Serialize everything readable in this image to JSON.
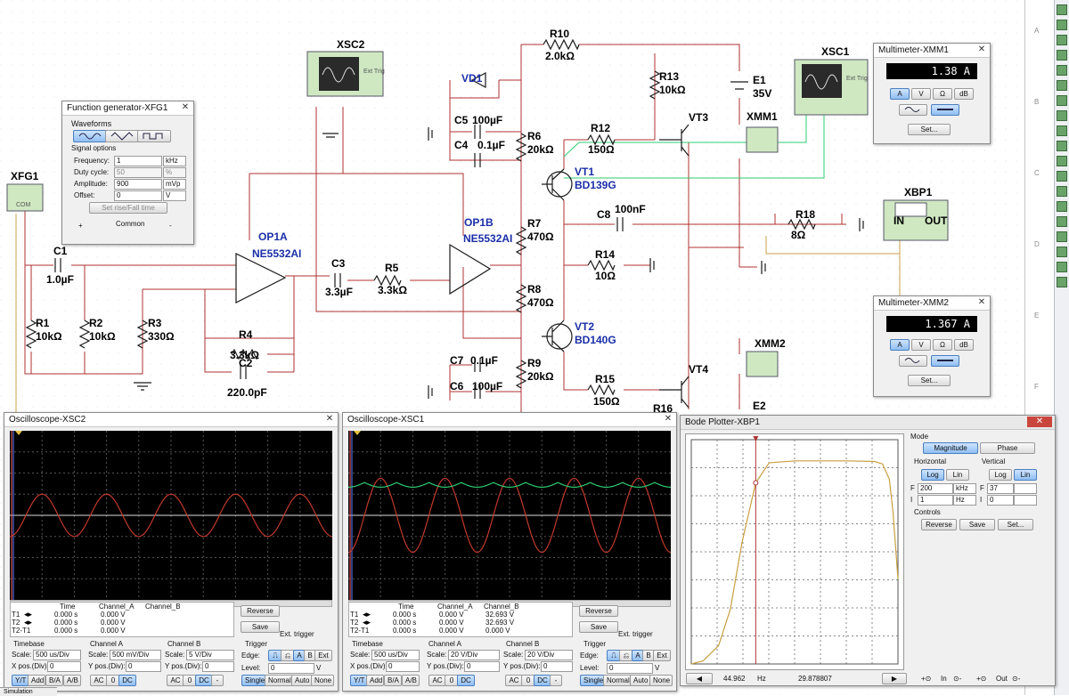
{
  "ruler": {
    "rows": [
      "A",
      "B",
      "C",
      "D",
      "E",
      "F"
    ]
  },
  "schematic": {
    "xfg1_label": "XFG1",
    "xsc2_label": "XSC2",
    "xsc1_label": "XSC1",
    "xbp1_label": "XBP1",
    "xmm1_label": "XMM1",
    "xmm2_label": "XMM2",
    "ext_trig": "Ext Trig",
    "vd1": "VD1",
    "vt1": "VT1",
    "vt1_part": "BD139G",
    "vt2": "VT2",
    "vt2_part": "BD140G",
    "vt3": "VT3",
    "vt4": "VT4",
    "e1": "E1",
    "e1_val": "35V",
    "e2": "E2",
    "op1a": "OP1A",
    "op1a_part": "NE5532AI",
    "op1b": "OP1B",
    "op1b_part": "NE5532AI",
    "c1": "C1",
    "c1_val": "1.0µF",
    "c2": "C2",
    "c2_val": "220.0pF",
    "c3": "C3",
    "c3_val": "3.3µF",
    "c4": "C4",
    "c4_val": "0.1µF",
    "c5": "C5",
    "c5_val": "100µF",
    "c6": "C6",
    "c6_val": "100µF",
    "c7": "C7",
    "c7_val": "0.1µF",
    "c8": "C8",
    "c8_val": "100nF",
    "r1": "R1",
    "r1_val": "10kΩ",
    "r2": "R2",
    "r2_val": "10kΩ",
    "r3": "R3",
    "r3_val": "330Ω",
    "r4": "R4",
    "r4_val": "3.3kΩ",
    "r5": "R5",
    "r5_val": "3.3kΩ",
    "r6": "R6",
    "r6_val": "20kΩ",
    "r7": "R7",
    "r7_val": "470Ω",
    "r8": "R8",
    "r8_val": "470Ω",
    "r9": "R9",
    "r9_val": "20kΩ",
    "r10": "R10",
    "r10_val": "2.0kΩ",
    "r12": "R12",
    "r12_val": "150Ω",
    "r13": "R13",
    "r13_val": "10kΩ",
    "r14": "R14",
    "r14_val": "10Ω",
    "r15": "R15",
    "r15_val": "150Ω",
    "r16": "R16",
    "r18": "R18",
    "r18_val": "8Ω",
    "in": "IN",
    "out": "OUT",
    "com": "COM"
  },
  "function_generator": {
    "title": "Function generator-XFG1",
    "waveforms_label": "Waveforms",
    "signal_options_label": "Signal options",
    "rows": [
      {
        "label": "Frequency:",
        "value": "1",
        "unit": "kHz"
      },
      {
        "label": "Duty cycle:",
        "value": "50",
        "unit": "%"
      },
      {
        "label": "Amplitude:",
        "value": "900",
        "unit": "mVp"
      },
      {
        "label": "Offset:",
        "value": "0",
        "unit": "V"
      }
    ],
    "rise_fall_button": "Set rise/Fall time",
    "plus": "+",
    "common": "Common",
    "minus": "-"
  },
  "multimeter1": {
    "title": "Multimeter-XMM1",
    "reading": "1.38 A",
    "modes": [
      "A",
      "V",
      "Ω",
      "dB"
    ],
    "set_button": "Set..."
  },
  "multimeter2": {
    "title": "Multimeter-XMM2",
    "reading": "1.367 A",
    "modes": [
      "A",
      "V",
      "Ω",
      "dB"
    ],
    "set_button": "Set..."
  },
  "osc_xsc2": {
    "title": "Oscilloscope-XSC2",
    "columns": [
      "Time",
      "Channel_A",
      "Channel_B"
    ],
    "rows": [
      {
        "name": "T1",
        "time": "0.000 s",
        "a": "0.000 V",
        "b": ""
      },
      {
        "name": "T2",
        "time": "0.000 s",
        "a": "0.000 V",
        "b": ""
      },
      {
        "name": "T2-T1",
        "time": "0.000 s",
        "a": "0.000 V",
        "b": ""
      }
    ],
    "reverse": "Reverse",
    "save": "Save",
    "ext_trigger": "Ext. trigger",
    "timebase": {
      "label": "Timebase",
      "scale_label": "Scale:",
      "scale": "500 us/Div",
      "pos_label": "X pos.(Div):",
      "pos": "0",
      "btns": [
        "Y/T",
        "Add",
        "B/A",
        "A/B"
      ]
    },
    "channel_a": {
      "label": "Channel A",
      "scale_label": "Scale:",
      "scale": "500 mV/Div",
      "pos_label": "Y pos.(Div):",
      "pos": "0",
      "btns": [
        "AC",
        "0",
        "DC"
      ]
    },
    "channel_b": {
      "label": "Channel B",
      "scale_label": "Scale:",
      "scale": "5 V/Div",
      "pos_label": "Y pos.(Div):",
      "pos": "0",
      "btns": [
        "AC",
        "0",
        "DC",
        "-"
      ]
    },
    "trigger": {
      "label": "Trigger",
      "edge_label": "Edge:",
      "level_label": "Level:",
      "level": "0",
      "level_unit": "V",
      "btns": [
        "A",
        "B",
        "Ext"
      ],
      "modes": [
        "Single",
        "Normal",
        "Auto",
        "None"
      ]
    }
  },
  "osc_xsc1": {
    "title": "Oscilloscope-XSC1",
    "columns": [
      "Time",
      "Channel_A",
      "Channel_B"
    ],
    "rows": [
      {
        "name": "T1",
        "time": "0.000 s",
        "a": "0.000 V",
        "b": "32.693 V"
      },
      {
        "name": "T2",
        "time": "0.000 s",
        "a": "0.000 V",
        "b": "32.693 V"
      },
      {
        "name": "T2-T1",
        "time": "0.000 s",
        "a": "0.000 V",
        "b": "0.000 V"
      }
    ],
    "reverse": "Reverse",
    "save": "Save",
    "ext_trigger": "Ext. trigger",
    "timebase": {
      "label": "Timebase",
      "scale_label": "Scale:",
      "scale": "500 us/Div",
      "pos_label": "X pos.(Div):",
      "pos": "0",
      "btns": [
        "Y/T",
        "Add",
        "B/A",
        "A/B"
      ]
    },
    "channel_a": {
      "label": "Channel A",
      "scale_label": "Scale:",
      "scale": "20 V/Div",
      "pos_label": "Y pos.(Div):",
      "pos": "0",
      "btns": [
        "AC",
        "0",
        "DC"
      ]
    },
    "channel_b": {
      "label": "Channel B",
      "scale_label": "Scale:",
      "scale": "20 V/Div",
      "pos_label": "Y pos.(Div):",
      "pos": "0",
      "btns": [
        "AC",
        "0",
        "DC",
        "-"
      ]
    },
    "trigger": {
      "label": "Trigger",
      "edge_label": "Edge:",
      "level_label": "Level:",
      "level": "0",
      "level_unit": "V",
      "btns": [
        "A",
        "B",
        "Ext"
      ],
      "modes": [
        "Single",
        "Normal",
        "Auto",
        "None"
      ]
    }
  },
  "bode": {
    "title": "Bode Plotter-XBP1",
    "mode_label": "Mode",
    "magnitude": "Magnitude",
    "phase": "Phase",
    "horizontal_label": "Horizontal",
    "vertical_label": "Vertical",
    "log": "Log",
    "lin": "Lin",
    "h_f": "200",
    "h_f_unit": "kHz",
    "h_i": "1",
    "h_i_unit": "Hz",
    "v_f": "37",
    "v_i": "0",
    "f_label": "F",
    "i_label": "I",
    "controls_label": "Controls",
    "reverse": "Reverse",
    "save": "Save",
    "set": "Set...",
    "cursor_freq": "44.962",
    "cursor_freq_unit": "Hz",
    "cursor_gain": "29.878807",
    "in_label": "In",
    "out_label": "Out"
  },
  "status": {
    "tab": "Simulation"
  },
  "chart_data": [
    {
      "type": "line",
      "title": "Oscilloscope-XSC2",
      "x_unit": "time",
      "x_scale_per_div": "500 us/Div",
      "x_divisions": 10,
      "series": [
        {
          "name": "Channel_A",
          "color": "#c0392b",
          "kind": "sine",
          "frequency_hz": 1000,
          "amplitude_div": 1.0,
          "offset_div": 0
        }
      ],
      "grid": true
    },
    {
      "type": "line",
      "title": "Oscilloscope-XSC1",
      "x_unit": "time",
      "x_scale_per_div": "500 us/Div",
      "x_divisions": 10,
      "series": [
        {
          "name": "Channel_A",
          "color": "#c0392b",
          "kind": "sine",
          "frequency_hz": 1000,
          "amplitude_div": 1.75,
          "offset_div": 0
        },
        {
          "name": "Channel_B",
          "color": "#2ecc71",
          "kind": "ripple",
          "frequency_hz": 2000,
          "level_div": 1.55,
          "ripple_div": 0.22
        }
      ],
      "grid": true
    },
    {
      "type": "line",
      "title": "Bode Plotter-XBP1",
      "x_scale": "log",
      "xlim": [
        1,
        200000
      ],
      "ylim": [
        0,
        37
      ],
      "series": [
        {
          "name": "Magnitude",
          "color": "#c8a040",
          "x": [
            1,
            2,
            5,
            10,
            20,
            44.962,
            100,
            500,
            1000,
            10000,
            50000,
            80000,
            120000,
            150000,
            200000
          ],
          "values": [
            0,
            0.5,
            3,
            9,
            20,
            29.878807,
            33.2,
            33.5,
            33.5,
            33.5,
            33.4,
            33.0,
            30.5,
            25.0,
            14.0
          ]
        }
      ],
      "cursor_x": 44.962,
      "grid": true
    }
  ]
}
